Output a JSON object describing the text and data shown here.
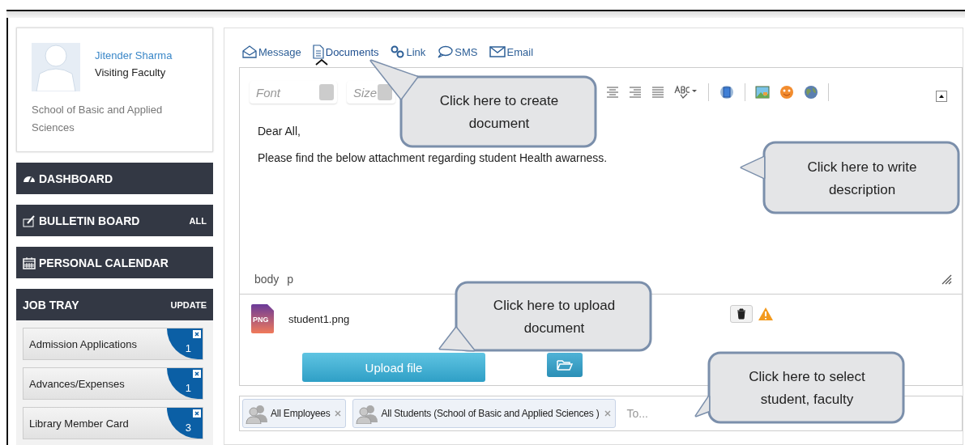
{
  "profile": {
    "name": "Jitender Sharma",
    "role": "Visiting Faculty",
    "school": "School of Basic and Applied Sciences"
  },
  "nav": [
    {
      "kind": "dashboard",
      "label": "DASHBOARD"
    },
    {
      "kind": "bulletin",
      "label": "BULLETIN BOARD",
      "action": "ALL"
    },
    {
      "kind": "calendar",
      "label": "PERSONAL CALENDAR"
    }
  ],
  "job_tray": {
    "title": "JOB TRAY",
    "action": "UPDATE",
    "items": [
      {
        "label": "Admission Applications",
        "count": "1"
      },
      {
        "label": "Advances/Expenses",
        "count": "1"
      },
      {
        "label": "Library Member Card",
        "count": "3"
      }
    ]
  },
  "compose_tabs": [
    {
      "kind": "message",
      "label": "Message",
      "selected": false
    },
    {
      "kind": "documents",
      "label": "Documents",
      "selected": true
    },
    {
      "kind": "link",
      "label": "Link",
      "selected": false
    },
    {
      "kind": "sms",
      "label": "SMS",
      "selected": false
    },
    {
      "kind": "email",
      "label": "Email",
      "selected": false
    }
  ],
  "editor": {
    "font_placeholder": "Font",
    "size_placeholder": "Size",
    "body": [
      "Dear All,",
      "Please find the below attachment regarding student Health awarness."
    ],
    "path": [
      "body",
      "p"
    ]
  },
  "attachment": {
    "file_type": "PNG",
    "filename": "student1.png"
  },
  "upload_button": "Upload file",
  "recipients": [
    {
      "label": "All Employees"
    },
    {
      "label": "All Students (School of Basic and Applied Sciences )"
    }
  ],
  "to_placeholder": "To...",
  "callouts": [
    {
      "kind": "create",
      "text": "Click here to create document"
    },
    {
      "kind": "write",
      "text": "Click here to write description"
    },
    {
      "kind": "upload",
      "text": "Click here to upload document"
    },
    {
      "kind": "select",
      "text": "Click here to select student, faculty"
    }
  ]
}
